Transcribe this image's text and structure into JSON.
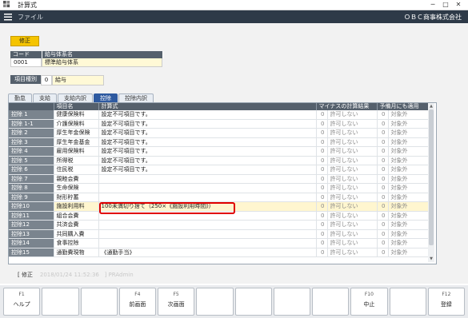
{
  "window": {
    "title": "計算式"
  },
  "menubar": {
    "file": "ファイル",
    "company": "ＯＢＣ商事株式会社"
  },
  "mode_badge": "修正",
  "kyuyo": {
    "code_label": "コード",
    "name_label": "給与体系名",
    "code": "0001",
    "name": "標準給与体系"
  },
  "item_type": {
    "label": "項目種別",
    "code": "0",
    "name": "給与"
  },
  "tabs": [
    "勤怠",
    "支給",
    "支給内訳",
    "控除",
    "控除内訳"
  ],
  "active_tab": "控除",
  "grid": {
    "headers": [
      "",
      "項目名",
      "計算式",
      "マイナスの計算結果",
      "",
      "予備月にも適用",
      ""
    ],
    "rows": [
      {
        "code": "控除 1",
        "name": "健康保険料",
        "formula": "設定不可項目です。",
        "minus_code": "0",
        "minus": "許可しない",
        "yobi_code": "0",
        "yobi": "対象外"
      },
      {
        "code": "控除 1-1",
        "name": "介護保険料",
        "formula": "設定不可項目です。",
        "minus_code": "0",
        "minus": "許可しない",
        "yobi_code": "0",
        "yobi": "対象外"
      },
      {
        "code": "控除 2",
        "name": "厚生年金保険",
        "formula": "設定不可項目です。",
        "minus_code": "0",
        "minus": "許可しない",
        "yobi_code": "0",
        "yobi": "対象外"
      },
      {
        "code": "控除 3",
        "name": "厚生年金基金",
        "formula": "設定不可項目です。",
        "minus_code": "0",
        "minus": "許可しない",
        "yobi_code": "0",
        "yobi": "対象外"
      },
      {
        "code": "控除 4",
        "name": "雇用保険料",
        "formula": "設定不可項目です。",
        "minus_code": "0",
        "minus": "許可しない",
        "yobi_code": "0",
        "yobi": "対象外"
      },
      {
        "code": "控除 5",
        "name": "所得税",
        "formula": "設定不可項目です。",
        "minus_code": "0",
        "minus": "許可しない",
        "yobi_code": "0",
        "yobi": "対象外"
      },
      {
        "code": "控除 6",
        "name": "住民税",
        "formula": "設定不可項目です。",
        "minus_code": "0",
        "minus": "許可しない",
        "yobi_code": "0",
        "yobi": "対象外"
      },
      {
        "code": "控除 7",
        "name": "親睦会費",
        "formula": "",
        "minus_code": "0",
        "minus": "許可しない",
        "yobi_code": "0",
        "yobi": "対象外"
      },
      {
        "code": "控除 8",
        "name": "生命保険",
        "formula": "",
        "minus_code": "0",
        "minus": "許可しない",
        "yobi_code": "0",
        "yobi": "対象外"
      },
      {
        "code": "控除 9",
        "name": "財形貯蓄",
        "formula": "",
        "minus_code": "0",
        "minus": "許可しない",
        "yobi_code": "0",
        "yobi": "対象外"
      },
      {
        "code": "控除10",
        "name": "施設利用料",
        "formula": "100未満切り捨て（250×《施設利用時間》）",
        "minus_code": "0",
        "minus": "許可しない",
        "yobi_code": "0",
        "yobi": "対象外"
      },
      {
        "code": "控除11",
        "name": "組合会費",
        "formula": "",
        "minus_code": "0",
        "minus": "許可しない",
        "yobi_code": "0",
        "yobi": "対象外"
      },
      {
        "code": "控除12",
        "name": "共済会費",
        "formula": "",
        "minus_code": "0",
        "minus": "許可しない",
        "yobi_code": "0",
        "yobi": "対象外"
      },
      {
        "code": "控除13",
        "name": "共同購入費",
        "formula": "",
        "minus_code": "0",
        "minus": "許可しない",
        "yobi_code": "0",
        "yobi": "対象外"
      },
      {
        "code": "控除14",
        "name": "食事控除",
        "formula": "",
        "minus_code": "0",
        "minus": "許可しない",
        "yobi_code": "0",
        "yobi": "対象外"
      },
      {
        "code": "控除15",
        "name": "通勤費現物",
        "formula": "《通勤手当》",
        "minus_code": "0",
        "minus": "許可しない",
        "yobi_code": "0",
        "yobi": "対象外"
      }
    ]
  },
  "status": {
    "mode": "[ 修正",
    "timestamp": "2018/01/24 11:52:36",
    "user": "] PRAdmin"
  },
  "fkeys": [
    {
      "key": "F1",
      "label": "ヘルプ"
    },
    {
      "key": "",
      "label": ""
    },
    {
      "key": "",
      "label": ""
    },
    {
      "key": "F4",
      "label": "前画面"
    },
    {
      "key": "F5",
      "label": "次画面"
    },
    {
      "key": "",
      "label": ""
    },
    {
      "key": "",
      "label": ""
    },
    {
      "key": "",
      "label": ""
    },
    {
      "key": "",
      "label": ""
    },
    {
      "key": "F10",
      "label": "中止"
    },
    {
      "key": "",
      "label": ""
    },
    {
      "key": "F12",
      "label": "登録"
    }
  ]
}
